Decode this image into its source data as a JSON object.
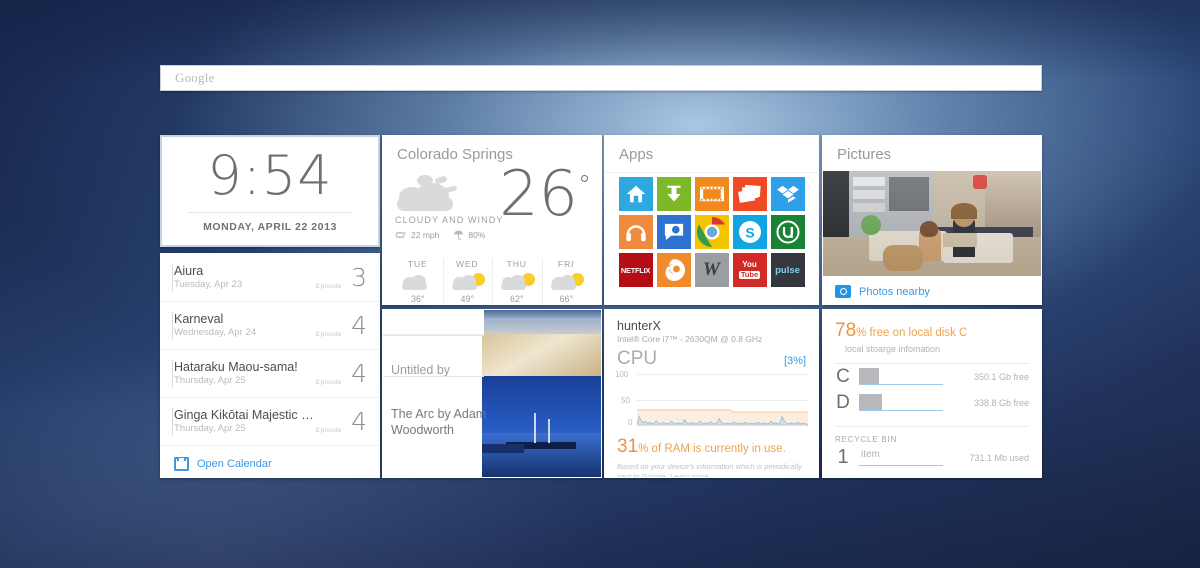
{
  "search": {
    "placeholder": "Google",
    "name": "google-search-bar"
  },
  "clock": {
    "time": "9:54",
    "date": "MONDAY, APRIL 22 2013"
  },
  "calendar": {
    "episode_label": "Episode",
    "open_label": "Open Calendar",
    "items": [
      {
        "title": "Aiura",
        "date": "Tuesday, Apr 23",
        "episode": "3"
      },
      {
        "title": "Karneval",
        "date": "Wednesday, Apr 24",
        "episode": "4"
      },
      {
        "title": "Hataraku Maou-sama!",
        "date": "Thursday, Apr 25",
        "episode": "4"
      },
      {
        "title": "Ginga Kikōtai Majestic Prince",
        "date": "Thursday, Apr 25",
        "episode": "4"
      }
    ]
  },
  "weather": {
    "city": "Colorado Springs",
    "temp": "26",
    "degree": "°",
    "condition": "CLOUDY  AND  WINDY",
    "wind": "22 mph",
    "precip": "80%",
    "forecast": [
      {
        "day": "TUE",
        "temp": "36°",
        "icon": "cloud"
      },
      {
        "day": "WED",
        "temp": "49°",
        "icon": "partly-sunny"
      },
      {
        "day": "THU",
        "temp": "62°",
        "icon": "partly-sunny"
      },
      {
        "day": "FRI",
        "temp": "66°",
        "icon": "partly-sunny"
      }
    ]
  },
  "apps": {
    "title": "Apps",
    "items": [
      {
        "name": "home-app-icon",
        "label": "Home",
        "bg": "#2fa8e0",
        "glyph": "home"
      },
      {
        "name": "download-app-icon",
        "label": "Downloads",
        "bg": "#7cb828",
        "glyph": "download"
      },
      {
        "name": "video-app-icon",
        "label": "Video",
        "bg": "#f08a1e",
        "glyph": "film"
      },
      {
        "name": "photos-app-icon",
        "label": "Photos",
        "bg": "#ef4a22",
        "glyph": "photos"
      },
      {
        "name": "dropbox-app-icon",
        "label": "Dropbox",
        "bg": "#2f9fe8",
        "glyph": "dropbox"
      },
      {
        "name": "music-app-icon",
        "label": "Music",
        "bg": "#f08a3c",
        "glyph": "headphones"
      },
      {
        "name": "plume-app-icon",
        "label": "Plume",
        "bg": "#2e72d2",
        "glyph": "chat"
      },
      {
        "name": "chrome-app-icon",
        "label": "Chrome",
        "bg": "#f5c400",
        "glyph": "chrome"
      },
      {
        "name": "skype-app-icon",
        "label": "Skype",
        "bg": "#12a5e3",
        "glyph": "skype"
      },
      {
        "name": "utorrent-app-icon",
        "label": "uTorrent",
        "bg": "#1a8236",
        "glyph": "utorrent"
      },
      {
        "name": "netflix-app-icon",
        "label": "NETFLIX",
        "bg": "#b40d15",
        "glyph": "netflix"
      },
      {
        "name": "crunchyroll-app-icon",
        "label": "Crunchyroll",
        "bg": "#f08a2a",
        "glyph": "crunchyroll"
      },
      {
        "name": "wikipedia-app-icon",
        "label": "W",
        "bg": "#9a9da2",
        "glyph": "wikipedia"
      },
      {
        "name": "youtube-app-icon",
        "label": "You Tube",
        "bg": "#d22b27",
        "glyph": "youtube"
      },
      {
        "name": "pulse-app-icon",
        "label": "pulse",
        "bg": "#34383c",
        "glyph": "pulse"
      }
    ]
  },
  "pictures": {
    "title": "Pictures",
    "nearby_label": "Photos nearby"
  },
  "photo_gallery": {
    "caption_previous": "Untitled by",
    "caption_current": "The Arc by Adam Woodworth"
  },
  "cpu": {
    "host": "hunterX",
    "processor": "Intel® Core i7™ - 2630QM @ 0.8 GHz",
    "label": "CPU",
    "usage": "[3%]",
    "axis": {
      "top": "100",
      "mid": "50",
      "bottom": "0"
    },
    "ram_value": "31",
    "ram_text": "% of RAM is currently in use.",
    "note": "Based on your device's information which is periodically sent to Google.  Learn more."
  },
  "disk": {
    "free_percent": "78",
    "free_text": "% free on local disk C",
    "subtitle": "local stoarge infomation",
    "drives": [
      {
        "letter": "C",
        "free": "350.1 Gb free",
        "used_pct": 22
      },
      {
        "letter": "D",
        "free": "338.8 Gb free",
        "used_pct": 26
      }
    ],
    "recycle_label": "RECYCLE BIN",
    "recycle_count": "1",
    "recycle_item_label": "item",
    "recycle_used": "731.1 Mb used"
  },
  "chart_data": {
    "type": "line",
    "title": "CPU",
    "ylabel": "",
    "xlabel": "",
    "ylim": [
      0,
      100
    ],
    "yticks": [
      0,
      50,
      100
    ],
    "grid": true,
    "legend": "none",
    "series": [
      {
        "name": "RAM",
        "color": "#f2c295",
        "values": [
          31,
          31,
          31,
          31,
          31,
          31,
          31,
          31,
          31,
          31,
          31,
          31,
          31,
          31,
          31,
          31,
          31,
          31,
          31,
          31,
          31,
          31,
          31,
          31,
          31,
          31,
          31,
          31,
          31,
          31,
          31,
          31,
          31,
          31,
          31,
          31,
          31,
          31,
          31,
          31,
          31,
          31,
          31,
          31,
          27,
          27,
          27,
          27,
          27,
          27,
          27,
          27,
          27,
          27,
          27,
          27,
          27,
          27,
          27,
          27,
          27,
          27,
          27,
          27,
          27,
          27,
          27,
          27,
          27,
          27,
          27,
          27,
          27,
          27,
          27,
          27,
          27,
          27,
          27,
          27
        ]
      },
      {
        "name": "CPU",
        "color": "#8fc6e0",
        "values": [
          3,
          18,
          10,
          6,
          9,
          5,
          7,
          4,
          6,
          10,
          5,
          4,
          7,
          5,
          4,
          6,
          9,
          5,
          4,
          6,
          4,
          5,
          12,
          6,
          4,
          5,
          7,
          4,
          5,
          9,
          4,
          5,
          6,
          4,
          8,
          5,
          4,
          6,
          14,
          7,
          4,
          5,
          6,
          4,
          5,
          8,
          4,
          6,
          5,
          4,
          7,
          5,
          4,
          6,
          4,
          5,
          7,
          4,
          5,
          6,
          4,
          5,
          9,
          4,
          6,
          5,
          4,
          18,
          10,
          5,
          4,
          6,
          5,
          4,
          7,
          5,
          4,
          6,
          4,
          3
        ]
      }
    ]
  }
}
